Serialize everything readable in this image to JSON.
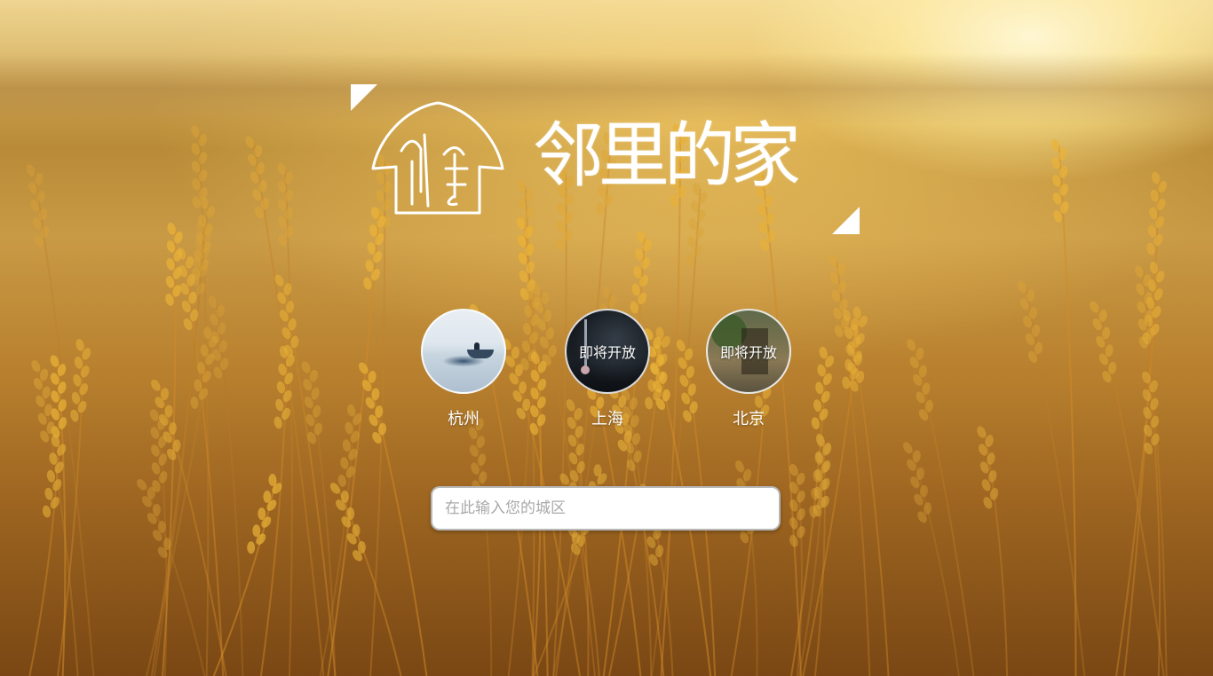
{
  "brand": {
    "title": "邻里的家",
    "logo_icon": "house-logo-icon"
  },
  "cities": [
    {
      "name": "杭州",
      "overlay": "",
      "status": "open",
      "thumbnail": "lake-boat"
    },
    {
      "name": "上海",
      "overlay": "即将开放",
      "status": "coming-soon",
      "thumbnail": "night-skyline"
    },
    {
      "name": "北京",
      "overlay": "即将开放",
      "status": "coming-soon",
      "thumbnail": "old-street"
    }
  ],
  "search": {
    "placeholder": "在此输入您的城区",
    "value": ""
  },
  "colors": {
    "accent": "#ffffff",
    "background_tone": "#c99a45"
  }
}
